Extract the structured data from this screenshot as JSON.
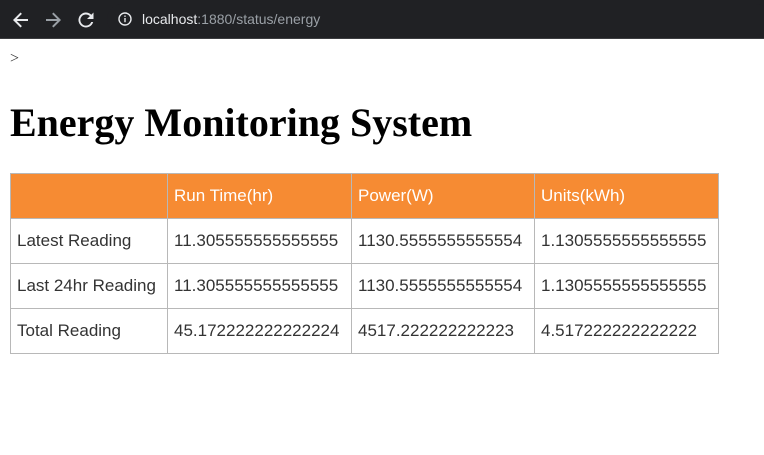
{
  "browser": {
    "url_host": "localhost",
    "url_path": ":1880/status/energy",
    "icons": {
      "back": "arrow-left-icon",
      "forward": "arrow-right-icon",
      "reload": "reload-icon",
      "info": "info-icon"
    }
  },
  "page": {
    "stray_text": ">",
    "title": "Energy Monitoring System"
  },
  "table": {
    "headers": [
      "",
      "Run Time(hr)",
      "Power(W)",
      "Units(kWh)"
    ],
    "rows": [
      {
        "label": "Latest Reading",
        "run_time": "11.305555555555555",
        "power": "1130.5555555555554",
        "units": "1.1305555555555555"
      },
      {
        "label": "Last 24hr Reading",
        "run_time": "11.305555555555555",
        "power": "1130.5555555555554",
        "units": "1.1305555555555555"
      },
      {
        "label": "Total Reading",
        "run_time": "45.172222222222224",
        "power": "4517.222222222223",
        "units": "4.517222222222222"
      }
    ]
  },
  "colors": {
    "header_bg": "#f68b33",
    "header_text": "#ffffff",
    "cell_text": "#333333",
    "border": "#b8b8b8",
    "browser_bg": "#202124"
  }
}
